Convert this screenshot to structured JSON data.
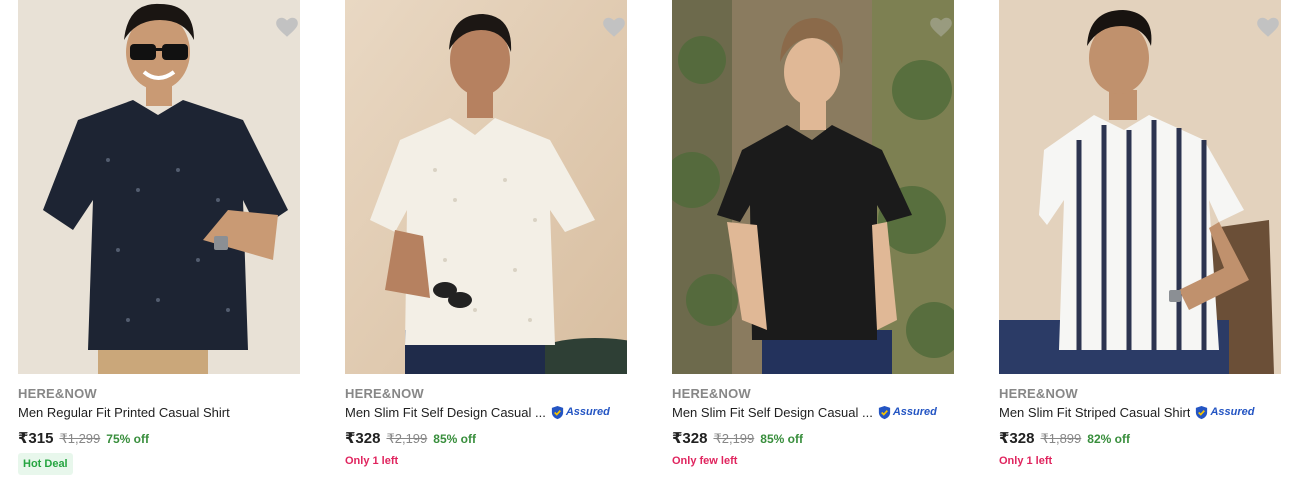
{
  "products": [
    {
      "brand": "HERE&NOW",
      "title": "Men Regular Fit Printed Casual Shirt",
      "assured": false,
      "price": "₹315",
      "mrp": "₹1,299",
      "discount": "75% off",
      "tag": "Hot Deal",
      "stock": ""
    },
    {
      "brand": "HERE&NOW",
      "title": "Men Slim Fit Self Design Casual ...",
      "assured": true,
      "assured_label": "Assured",
      "price": "₹328",
      "mrp": "₹2,199",
      "discount": "85% off",
      "tag": "",
      "stock": "Only 1 left"
    },
    {
      "brand": "HERE&NOW",
      "title": "Men Slim Fit Self Design Casual ...",
      "assured": true,
      "assured_label": "Assured",
      "price": "₹328",
      "mrp": "₹2,199",
      "discount": "85% off",
      "tag": "",
      "stock": "Only few left"
    },
    {
      "brand": "HERE&NOW",
      "title": "Men Slim Fit Striped Casual Shirt",
      "assured": true,
      "assured_label": "Assured",
      "price": "₹328",
      "mrp": "₹1,899",
      "discount": "82% off",
      "tag": "",
      "stock": "Only 1 left"
    }
  ],
  "colors": {
    "discount": "#388e3c",
    "stock": "#e0245e",
    "assured": "#2455c3",
    "brand": "#878787"
  },
  "icons": {
    "wishlist": "heart-icon",
    "assured": "shield-check-icon"
  }
}
